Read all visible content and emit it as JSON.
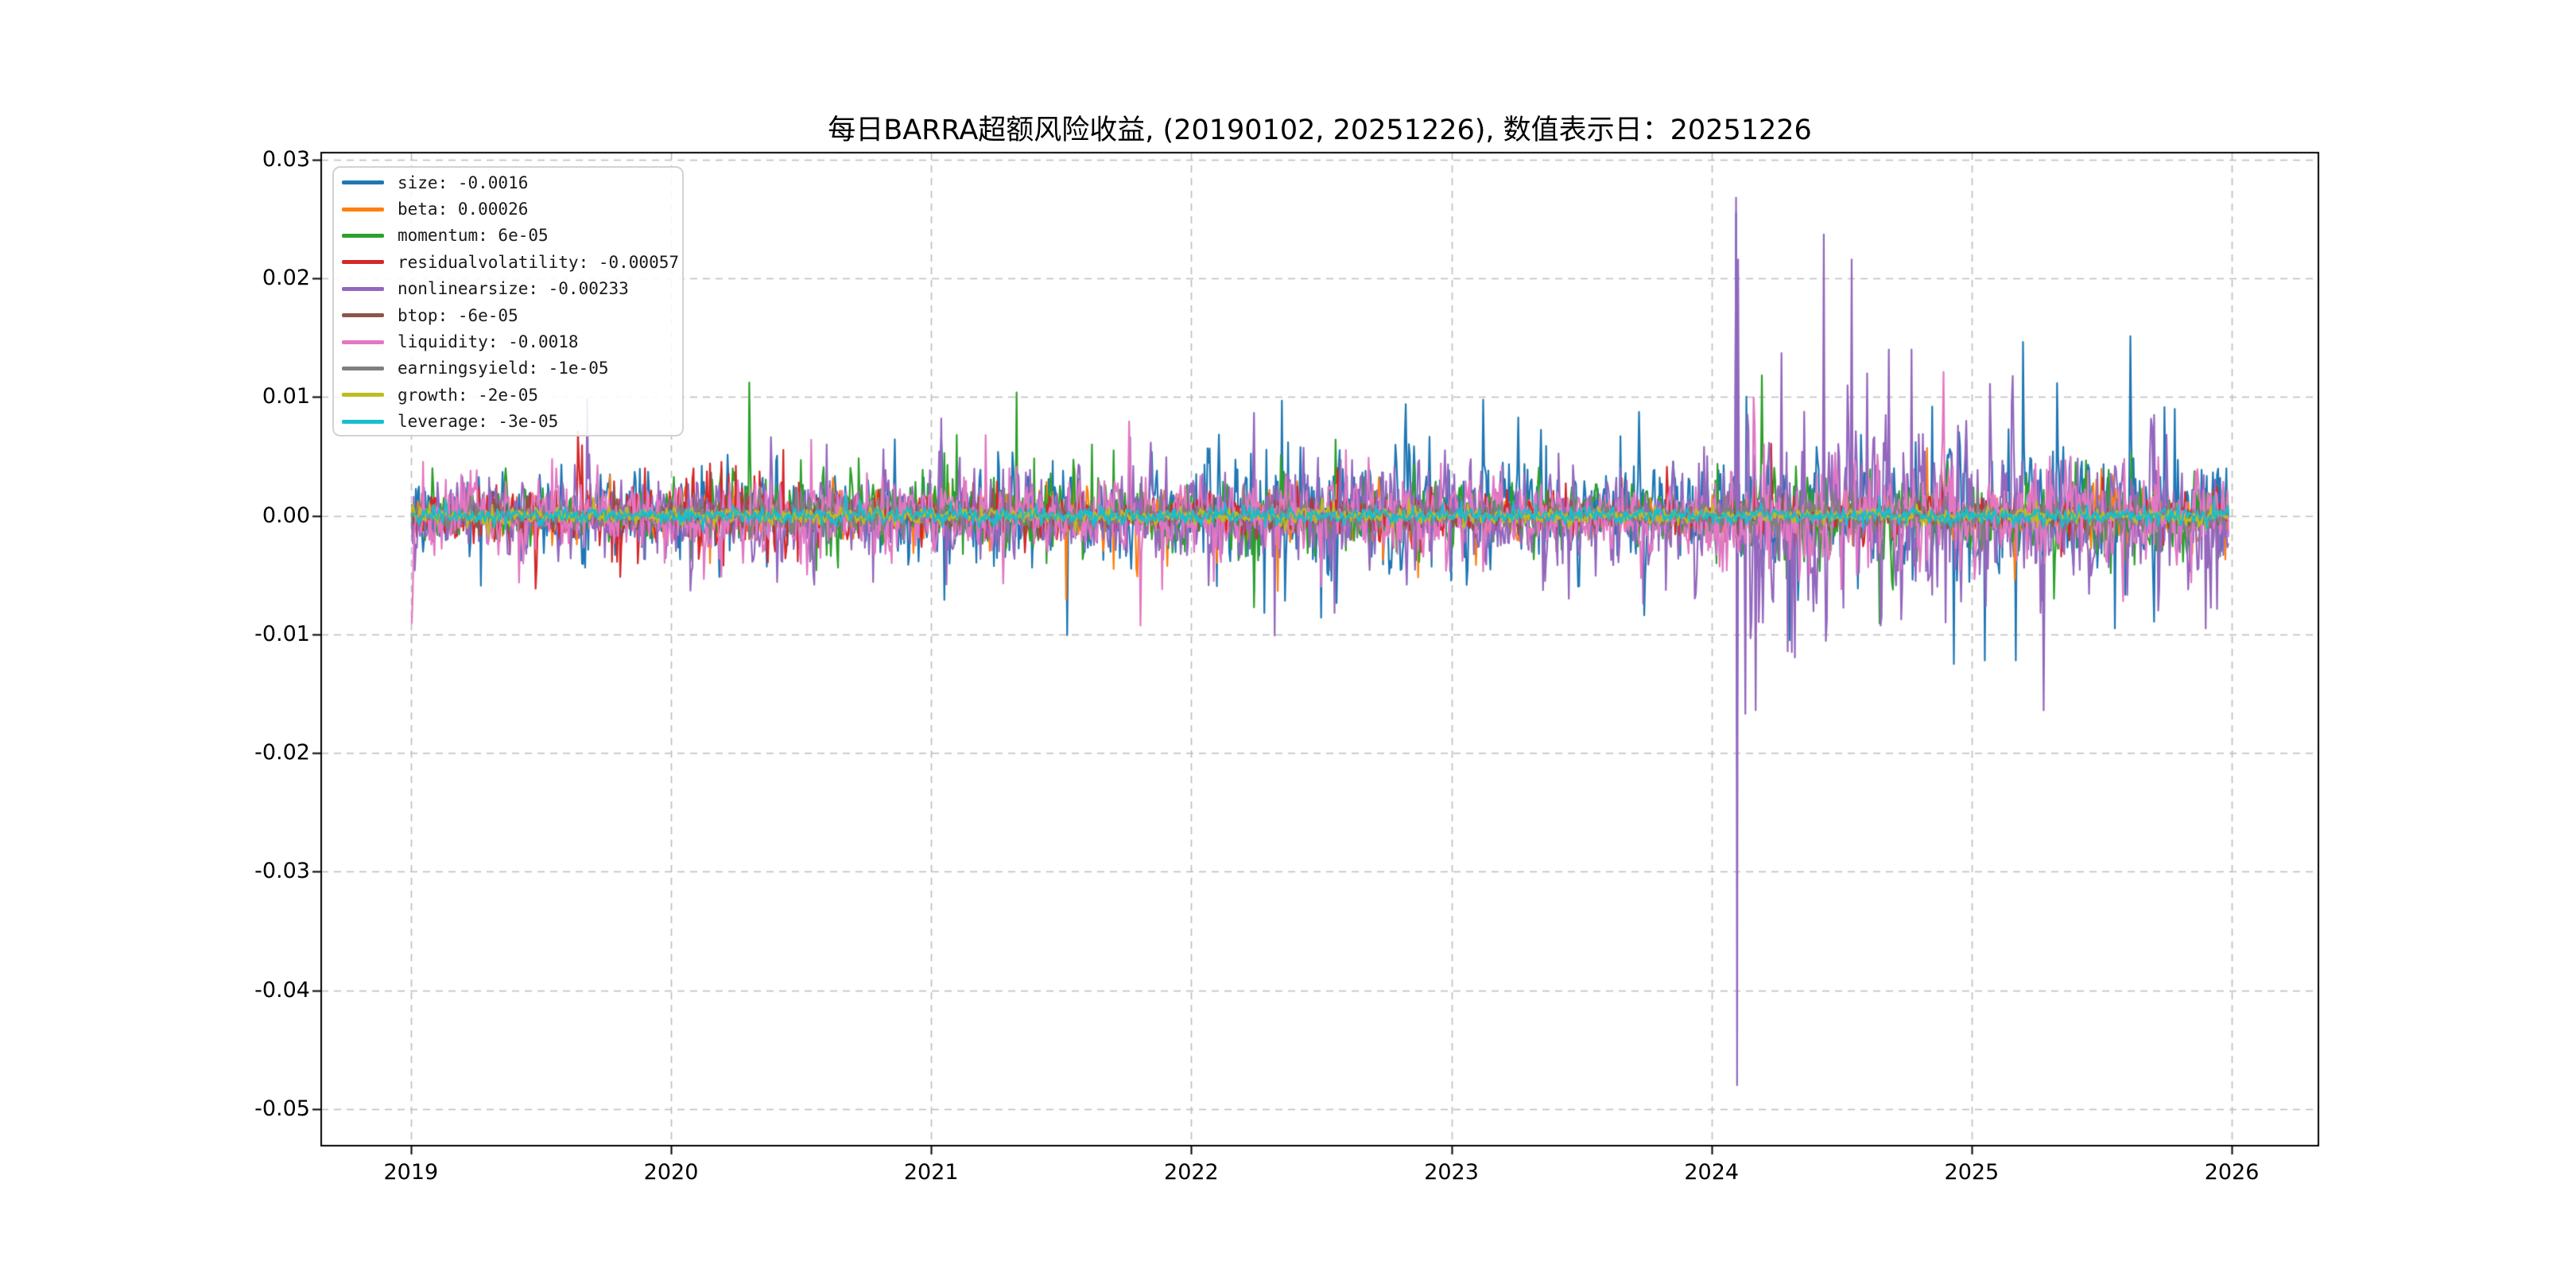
{
  "figure": {
    "background": "#ffffff"
  },
  "chart_data": {
    "type": "line",
    "title": "每日BARRA超额风险收益, (20190102, 20251226),  数值表示日：20251226",
    "data_start_date": "20190102",
    "data_end_date": "20251226",
    "value_label_date": "20251226",
    "grid": {
      "style": "dashed",
      "color": "#bdbdbd"
    },
    "legend": {
      "position": "upper-left"
    },
    "x_axis": {
      "range": [
        2018.655,
        2026.333
      ],
      "ticks": [
        {
          "value": 2019,
          "label": "2019"
        },
        {
          "value": 2020,
          "label": "2020"
        },
        {
          "value": 2021,
          "label": "2021"
        },
        {
          "value": 2022,
          "label": "2022"
        },
        {
          "value": 2023,
          "label": "2023"
        },
        {
          "value": 2024,
          "label": "2024"
        },
        {
          "value": 2025,
          "label": "2025"
        },
        {
          "value": 2026,
          "label": "2026"
        }
      ]
    },
    "y_axis": {
      "range": [
        -0.0531,
        0.0306
      ],
      "ticks": [
        {
          "value": 0.03,
          "label": "0.03"
        },
        {
          "value": 0.02,
          "label": "0.02"
        },
        {
          "value": 0.01,
          "label": "0.01"
        },
        {
          "value": 0.0,
          "label": "0.00"
        },
        {
          "value": -0.01,
          "label": "-0.01"
        },
        {
          "value": -0.02,
          "label": "-0.02"
        },
        {
          "value": -0.03,
          "label": "-0.03"
        },
        {
          "value": -0.04,
          "label": "-0.04"
        },
        {
          "value": -0.05,
          "label": "-0.05"
        }
      ]
    },
    "x_start": 2019.003,
    "x_end": 2025.986,
    "points_per_year": 252,
    "series": [
      {
        "name": "size",
        "color": "#1f77b4",
        "last_value": -0.0016,
        "legend_label": "size: -0.0016",
        "seed": 1,
        "volatility_eras": [
          [
            2019,
            0.0013
          ],
          [
            2020,
            0.0014
          ],
          [
            2021,
            0.0017
          ],
          [
            2022,
            0.0024
          ],
          [
            2023,
            0.0017
          ],
          [
            2024,
            0.0026
          ],
          [
            2025,
            0.0025
          ]
        ],
        "spikes": [
          [
            2019.27,
            -0.0059
          ],
          [
            2020.12,
            0.0042
          ],
          [
            2021.05,
            -0.0071
          ],
          [
            2022.28,
            -0.0082
          ],
          [
            2022.35,
            0.0097
          ],
          [
            2022.5,
            -0.0086
          ],
          [
            2023.65,
            0.0067
          ],
          [
            2024.094,
            0.0255
          ],
          [
            2024.098,
            -0.0185
          ],
          [
            2024.3,
            -0.0105
          ],
          [
            2024.85,
            0.0092
          ],
          [
            2024.93,
            -0.0125
          ],
          [
            2025.05,
            -0.0122
          ],
          [
            2025.17,
            -0.0122
          ],
          [
            2025.55,
            -0.0095
          ],
          [
            2025.78,
            0.009
          ]
        ]
      },
      {
        "name": "beta",
        "color": "#ff7f0e",
        "last_value": 0.00026,
        "legend_label": "beta: 0.00026",
        "seed": 2,
        "volatility_eras": [
          [
            2019,
            0.0007
          ],
          [
            2020,
            0.0008
          ],
          [
            2021,
            0.0009
          ],
          [
            2022,
            0.0009
          ],
          [
            2023,
            0.0007
          ],
          [
            2024,
            0.0008
          ],
          [
            2025,
            0.0009
          ]
        ],
        "spikes": [
          [
            2020.15,
            -0.004
          ],
          [
            2021.55,
            0.004
          ],
          [
            2021.7,
            -0.0045
          ],
          [
            2022.1,
            -0.004
          ],
          [
            2025.6,
            -0.003
          ],
          [
            2025.85,
            -0.0032
          ]
        ]
      },
      {
        "name": "momentum",
        "color": "#2ca02c",
        "last_value": 6e-05,
        "legend_label": "momentum: 6e-05",
        "seed": 3,
        "volatility_eras": [
          [
            2019,
            0.0009
          ],
          [
            2020,
            0.0015
          ],
          [
            2021,
            0.0015
          ],
          [
            2022,
            0.0013
          ],
          [
            2023,
            0.0011
          ],
          [
            2024,
            0.0016
          ],
          [
            2025,
            0.0014
          ]
        ],
        "spikes": [
          [
            2020.5,
            0.0047
          ],
          [
            2020.56,
            -0.0046
          ],
          [
            2021.1,
            0.0068
          ],
          [
            2021.62,
            0.006
          ],
          [
            2021.7,
            0.0055
          ],
          [
            2024.2,
            0.005
          ],
          [
            2024.6,
            0.005
          ],
          [
            2025.4,
            0.0045
          ]
        ]
      },
      {
        "name": "residualvolatility",
        "color": "#d62728",
        "last_value": -0.00057,
        "legend_label": "residualvolatility: -0.00057",
        "seed": 4,
        "volatility_eras": [
          [
            2019,
            0.0011
          ],
          [
            2020,
            0.0017
          ],
          [
            2020.5,
            0.0008
          ],
          [
            2021,
            0.0007
          ],
          [
            2022,
            0.0008
          ],
          [
            2023,
            0.0006
          ],
          [
            2024,
            0.0008
          ],
          [
            2025,
            0.0007
          ]
        ],
        "spikes": [
          [
            2019.9,
            0.004
          ],
          [
            2020.15,
            0.0044
          ],
          [
            2020.2,
            -0.0042
          ],
          [
            2020.25,
            0.0042
          ],
          [
            2024.1,
            0.004
          ]
        ]
      },
      {
        "name": "nonlinearsize",
        "color": "#9467bd",
        "last_value": -0.00233,
        "legend_label": "nonlinearsize: -0.00233",
        "seed": 5,
        "volatility_eras": [
          [
            2019,
            0.0013
          ],
          [
            2020,
            0.0015
          ],
          [
            2021,
            0.0017
          ],
          [
            2022,
            0.0021
          ],
          [
            2023,
            0.0016
          ],
          [
            2024,
            0.002
          ],
          [
            2024.1,
            0.0036
          ],
          [
            2025,
            0.0026
          ]
        ],
        "spikes": [
          [
            2020.6,
            0.006
          ],
          [
            2021.04,
            0.0082
          ],
          [
            2021.06,
            -0.0058
          ],
          [
            2022.32,
            -0.0101
          ],
          [
            2022.55,
            -0.0082
          ],
          [
            2023.45,
            -0.007
          ],
          [
            2023.97,
            0.0058
          ],
          [
            2024.094,
            0.0268
          ],
          [
            2024.098,
            -0.048
          ],
          [
            2024.102,
            0.0216
          ],
          [
            2024.13,
            -0.0167
          ],
          [
            2024.17,
            -0.0164
          ],
          [
            2024.27,
            0.0137
          ],
          [
            2024.31,
            -0.0115
          ],
          [
            2024.43,
            0.0237
          ],
          [
            2024.54,
            0.0216
          ],
          [
            2024.6,
            0.012
          ],
          [
            2024.68,
            0.014
          ],
          [
            2024.77,
            0.014
          ],
          [
            2024.9,
            -0.009
          ],
          [
            2025.7,
            0.0085
          ],
          [
            2025.9,
            -0.0095
          ]
        ]
      },
      {
        "name": "btop",
        "color": "#8c564b",
        "last_value": -6e-05,
        "legend_label": "btop: -6e-05",
        "seed": 6,
        "volatility_eras": [
          [
            2019,
            0.00045
          ]
        ],
        "spikes": [
          [
            2024.1,
            -0.0025
          ]
        ]
      },
      {
        "name": "liquidity",
        "color": "#e377c2",
        "last_value": -0.0018,
        "legend_label": "liquidity: -0.0018",
        "seed": 7,
        "volatility_eras": [
          [
            2019,
            0.0013
          ],
          [
            2020,
            0.0014
          ],
          [
            2021,
            0.0013
          ],
          [
            2022,
            0.0015
          ],
          [
            2023,
            0.0013
          ],
          [
            2024,
            0.0019
          ],
          [
            2025,
            0.0017
          ]
        ],
        "spikes": [
          [
            2020.54,
            0.0064
          ],
          [
            2021.3,
            0.004
          ],
          [
            2022.5,
            -0.006
          ],
          [
            2024.2,
            0.006
          ],
          [
            2024.5,
            -0.0062
          ],
          [
            2025.3,
            0.005
          ]
        ]
      },
      {
        "name": "earningsyield",
        "color": "#7f7f7f",
        "last_value": -1e-05,
        "legend_label": "earningsyield: -1e-05",
        "seed": 8,
        "volatility_eras": [
          [
            2019,
            0.00035
          ],
          [
            2020.3,
            0.0008
          ],
          [
            2020.8,
            0.0004
          ],
          [
            2024,
            0.0006
          ],
          [
            2025,
            0.0005
          ]
        ],
        "spikes": [
          [
            2024.9,
            0.0016
          ],
          [
            2024.92,
            -0.0016
          ]
        ]
      },
      {
        "name": "growth",
        "color": "#bcbd22",
        "last_value": -2e-05,
        "legend_label": "growth: -2e-05",
        "seed": 9,
        "volatility_eras": [
          [
            2019,
            0.00028
          ]
        ],
        "spikes": []
      },
      {
        "name": "leverage",
        "color": "#17becf",
        "last_value": -3e-05,
        "legend_label": "leverage: -3e-05",
        "seed": 10,
        "volatility_eras": [
          [
            2019,
            0.00028
          ]
        ],
        "spikes": []
      }
    ]
  }
}
